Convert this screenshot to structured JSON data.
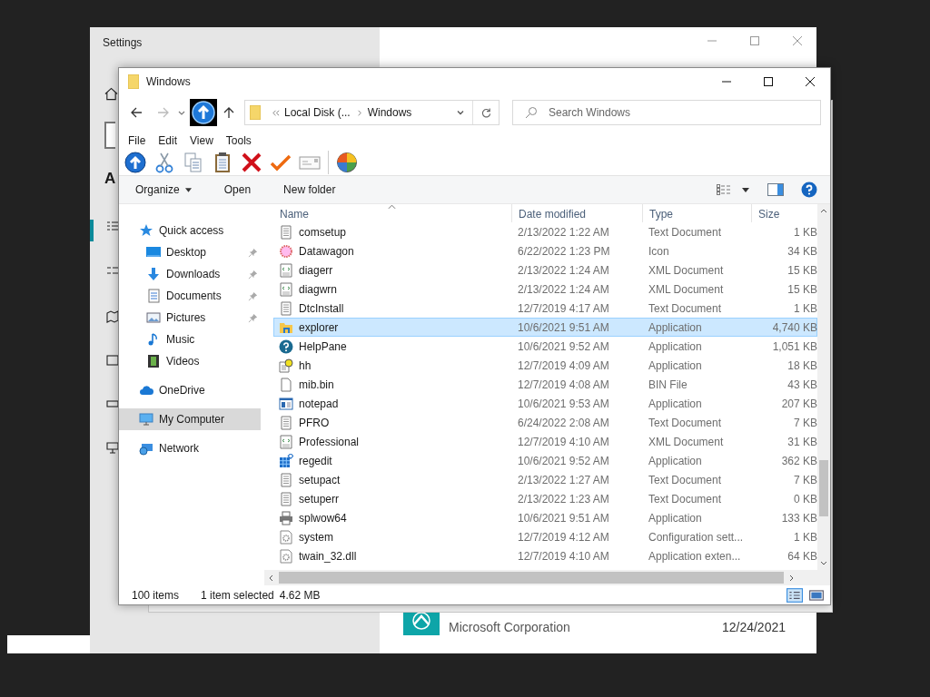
{
  "settings": {
    "title": "Settings",
    "sidebar_heading": "A",
    "app_entry": {
      "publisher": "Microsoft Corporation",
      "date": "12/24/2021"
    }
  },
  "explorer": {
    "title": "Windows",
    "address": {
      "crumbs": [
        "Local Disk (...",
        "Windows"
      ]
    },
    "search": {
      "placeholder": "Search Windows"
    },
    "menu": [
      "File",
      "Edit",
      "View",
      "Tools"
    ],
    "commands": [
      {
        "label": "Organize",
        "dropdown": true
      },
      {
        "label": "Open",
        "dropdown": false
      },
      {
        "label": "New folder",
        "dropdown": false
      }
    ],
    "nav": [
      {
        "label": "Quick access",
        "kind": "star",
        "selected": false,
        "children": [
          {
            "label": "Desktop",
            "kind": "desktop",
            "pinned": true,
            "selected": false
          },
          {
            "label": "Downloads",
            "kind": "download",
            "pinned": true,
            "selected": false
          },
          {
            "label": "Documents",
            "kind": "document",
            "pinned": true,
            "selected": false
          },
          {
            "label": "Pictures",
            "kind": "picture",
            "pinned": true,
            "selected": false
          },
          {
            "label": "Music",
            "kind": "music",
            "pinned": false,
            "selected": false
          },
          {
            "label": "Videos",
            "kind": "video",
            "pinned": false,
            "selected": false
          }
        ]
      },
      {
        "label": "OneDrive",
        "kind": "cloud",
        "selected": false
      },
      {
        "label": "My Computer",
        "kind": "computer",
        "selected": true
      },
      {
        "label": "Network",
        "kind": "network",
        "selected": false
      }
    ],
    "columns": [
      "Name",
      "Date modified",
      "Type",
      "Size"
    ],
    "rows": [
      {
        "name": "comsetup",
        "date": "2/13/2022 1:22 AM",
        "type": "Text Document",
        "size": "1 KB",
        "kind": "text",
        "selected": false
      },
      {
        "name": "Datawagon",
        "date": "6/22/2022 1:23 PM",
        "type": "Icon",
        "size": "34 KB",
        "kind": "icon",
        "selected": false
      },
      {
        "name": "diagerr",
        "date": "2/13/2022 1:24 AM",
        "type": "XML Document",
        "size": "15 KB",
        "kind": "xml",
        "selected": false
      },
      {
        "name": "diagwrn",
        "date": "2/13/2022 1:24 AM",
        "type": "XML Document",
        "size": "15 KB",
        "kind": "xml",
        "selected": false
      },
      {
        "name": "DtcInstall",
        "date": "12/7/2019 4:17 AM",
        "type": "Text Document",
        "size": "1 KB",
        "kind": "text",
        "selected": false
      },
      {
        "name": "explorer",
        "date": "10/6/2021 9:51 AM",
        "type": "Application",
        "size": "4,740 KB",
        "kind": "folderapp",
        "selected": true
      },
      {
        "name": "HelpPane",
        "date": "10/6/2021 9:52 AM",
        "type": "Application",
        "size": "1,051 KB",
        "kind": "help",
        "selected": false
      },
      {
        "name": "hh",
        "date": "12/7/2019 4:09 AM",
        "type": "Application",
        "size": "18 KB",
        "kind": "helpdoc",
        "selected": false
      },
      {
        "name": "mib.bin",
        "date": "12/7/2019 4:08 AM",
        "type": "BIN File",
        "size": "43 KB",
        "kind": "blank",
        "selected": false
      },
      {
        "name": "notepad",
        "date": "10/6/2021 9:53 AM",
        "type": "Application",
        "size": "207 KB",
        "kind": "window",
        "selected": false
      },
      {
        "name": "PFRO",
        "date": "6/24/2022 2:08 AM",
        "type": "Text Document",
        "size": "7 KB",
        "kind": "text",
        "selected": false
      },
      {
        "name": "Professional",
        "date": "12/7/2019 4:10 AM",
        "type": "XML Document",
        "size": "31 KB",
        "kind": "xml",
        "selected": false
      },
      {
        "name": "regedit",
        "date": "10/6/2021 9:52 AM",
        "type": "Application",
        "size": "362 KB",
        "kind": "grid",
        "selected": false
      },
      {
        "name": "setupact",
        "date": "2/13/2022 1:27 AM",
        "type": "Text Document",
        "size": "7 KB",
        "kind": "text",
        "selected": false
      },
      {
        "name": "setuperr",
        "date": "2/13/2022 1:23 AM",
        "type": "Text Document",
        "size": "0 KB",
        "kind": "text",
        "selected": false
      },
      {
        "name": "splwow64",
        "date": "10/6/2021 9:51 AM",
        "type": "Application",
        "size": "133 KB",
        "kind": "printer",
        "selected": false
      },
      {
        "name": "system",
        "date": "12/7/2019 4:12 AM",
        "type": "Configuration sett...",
        "size": "1 KB",
        "kind": "gear",
        "selected": false
      },
      {
        "name": "twain_32.dll",
        "date": "12/7/2019 4:10 AM",
        "type": "Application exten...",
        "size": "64 KB",
        "kind": "gear",
        "selected": false
      }
    ],
    "status": {
      "count": "100 items",
      "selection": "1 item selected",
      "selection_size": "4.62 MB"
    }
  }
}
